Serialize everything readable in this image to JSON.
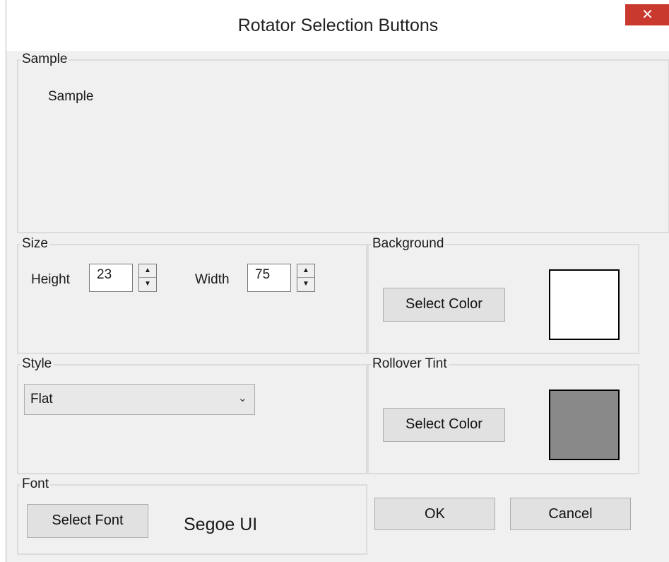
{
  "window": {
    "title": "Rotator Selection Buttons",
    "close_glyph": "✕"
  },
  "sample": {
    "legend": "Sample",
    "text": "Sample"
  },
  "size": {
    "legend": "Size",
    "height_label": "Height",
    "height_value": "23",
    "width_label": "Width",
    "width_value": "75",
    "spin_up": "▲",
    "spin_down": "▼"
  },
  "background": {
    "legend": "Background",
    "button_label": "Select Color",
    "swatch_color": "#ffffff"
  },
  "style": {
    "legend": "Style",
    "selected": "Flat",
    "arrow": "⌄"
  },
  "rollover": {
    "legend": "Rollover Tint",
    "button_label": "Select Color",
    "swatch_color": "#898989"
  },
  "font": {
    "legend": "Font",
    "button_label": "Select Font",
    "current": "Segoe UI"
  },
  "actions": {
    "ok": "OK",
    "cancel": "Cancel"
  }
}
